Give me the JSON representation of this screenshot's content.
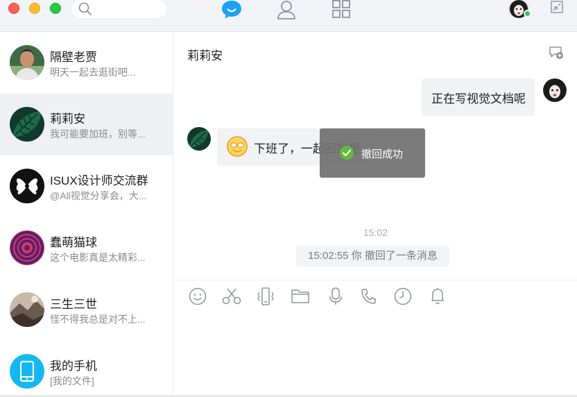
{
  "topbar": {
    "window_controls": [
      "close",
      "minimize",
      "maximize"
    ],
    "search": {
      "icon": "search-icon",
      "value": ""
    },
    "nav": [
      {
        "icon": "chat-bubble-icon",
        "active": true
      },
      {
        "icon": "contacts-icon",
        "active": false
      },
      {
        "icon": "apps-grid-icon",
        "active": false
      }
    ],
    "status": "online",
    "right_icon": "shrink-window-icon"
  },
  "sidebar": {
    "items": [
      {
        "name": "隔壁老贾",
        "preview": "明天一起去逛街吧...",
        "avatar": "person-portrait"
      },
      {
        "name": "莉莉安",
        "preview": "我可能要加班，别等...",
        "avatar": "monstera-leaf",
        "active": true
      },
      {
        "name": "ISUX设计师交流群",
        "preview": "@All视觉分享会，大...",
        "avatar": "isux-logo"
      },
      {
        "name": "蠢萌猫球",
        "preview": "这个电影真是太精彩...",
        "avatar": "spiral-swirl"
      },
      {
        "name": "三生三世",
        "preview": "怪不得我总是对不上...",
        "avatar": "mountain-photo"
      },
      {
        "name": "我的手机",
        "preview": "[我的文件]",
        "avatar": "phone-icon"
      }
    ]
  },
  "chat": {
    "title": "莉莉安",
    "title_icon": "add-chat-icon",
    "messages": [
      {
        "direction": "outgoing",
        "text": "正在写视觉文档呢"
      },
      {
        "direction": "incoming",
        "emoji": "smiley-glasses-emoji",
        "text": "下班了，一起回家吧"
      }
    ],
    "toast": {
      "icon": "check-circle-icon",
      "text": "撤回成功"
    },
    "time": "15:02",
    "recall_notice": "15:02:55 你 撤回了一条消息",
    "toolbar": [
      "emoji-icon",
      "scissors-icon",
      "shake-phone-icon",
      "folder-icon",
      "microphone-icon",
      "phone-call-icon",
      "history-clock-icon",
      "bell-icon"
    ]
  },
  "colors": {
    "accent": "#1aa3f5",
    "online": "#36c55a",
    "toast_bg": "#707070",
    "check": "#5fbd38"
  }
}
